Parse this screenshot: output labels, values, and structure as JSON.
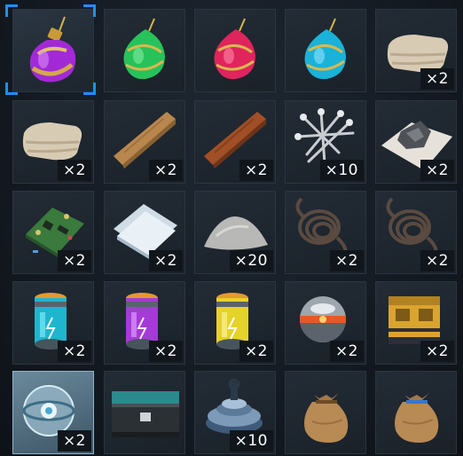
{
  "inventory": {
    "slots": [
      {
        "item": "purple-potion-icon",
        "qty": ""
      },
      {
        "item": "green-potion-icon",
        "qty": ""
      },
      {
        "item": "red-potion-icon",
        "qty": ""
      },
      {
        "item": "blue-potion-icon",
        "qty": ""
      },
      {
        "item": "cloth-icon",
        "qty": "×2"
      },
      {
        "item": "cloth-icon",
        "qty": "×2"
      },
      {
        "item": "light-wood-plank-icon",
        "qty": "×2"
      },
      {
        "item": "dark-wood-plank-icon",
        "qty": "×2"
      },
      {
        "item": "nails-icon",
        "qty": "×10"
      },
      {
        "item": "ore-on-paper-icon",
        "qty": "×2"
      },
      {
        "item": "circuit-board-icon",
        "qty": "×2"
      },
      {
        "item": "paper-sheets-icon",
        "qty": "×2"
      },
      {
        "item": "powder-pile-icon",
        "qty": "×20"
      },
      {
        "item": "wire-coil-icon",
        "qty": "×2"
      },
      {
        "item": "wire-coil-icon",
        "qty": "×2"
      },
      {
        "item": "cyan-energy-canister-icon",
        "qty": "×2"
      },
      {
        "item": "purple-energy-canister-icon",
        "qty": "×2"
      },
      {
        "item": "yellow-energy-canister-icon",
        "qty": "×2"
      },
      {
        "item": "energy-core-sphere-icon",
        "qty": "×2"
      },
      {
        "item": "yellow-crate-icon",
        "qty": "×2"
      },
      {
        "item": "glass-orb-icon",
        "qty": "×2"
      },
      {
        "item": "dark-chest-icon",
        "qty": ""
      },
      {
        "item": "metal-weight-icon",
        "qty": "×10"
      },
      {
        "item": "loot-sack-icon",
        "qty": ""
      },
      {
        "item": "loot-sack-blue-icon",
        "qty": ""
      }
    ]
  },
  "colors": {
    "selection": "#1e8fff",
    "slot_bg": "#1f2730",
    "highlight_bg": "#5f7d8f"
  }
}
